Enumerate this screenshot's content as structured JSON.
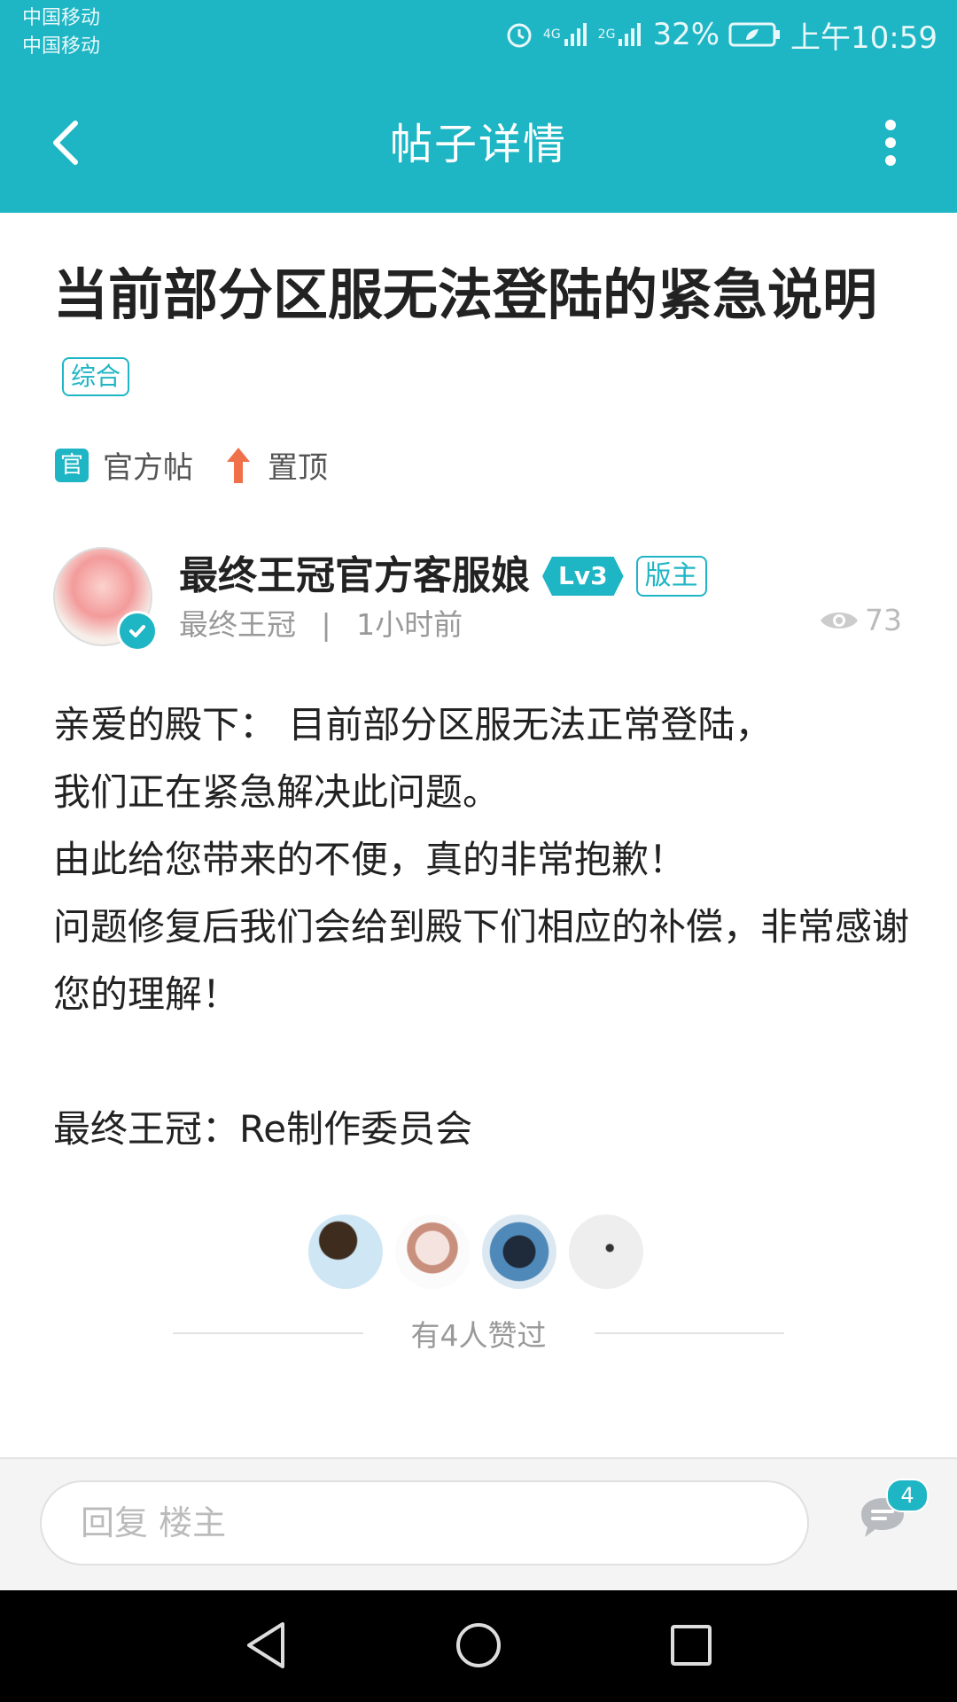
{
  "status_bar": {
    "carrier_1": "中国移动",
    "carrier_2": "中国移动",
    "net_1": "4G",
    "net_2": "2G",
    "battery": "32%",
    "time": "上午10:59"
  },
  "header": {
    "title": "帖子详情",
    "icons": {
      "back": "chevron-left-icon",
      "more": "more-vertical-icon"
    }
  },
  "post": {
    "title": "当前部分区服无法登陆的紧急说明",
    "category": "综合",
    "badges": {
      "official_icon": "官",
      "official": "官方帖",
      "pinned": "置顶"
    },
    "author": {
      "name": "最终王冠官方客服娘",
      "level": "Lv3",
      "role": "版主",
      "source": "最终王冠",
      "separator": "|",
      "time": "1小时前"
    },
    "views": "73",
    "body": [
      "亲爱的殿下： 目前部分区服无法正常登陆，",
      "我们正在紧急解决此问题。",
      "由此给您带来的不便，真的非常抱歉！",
      "问题修复后我们会给到殿下们相应的补偿，非常感谢您的理解！",
      "最终王冠：Re制作委员会"
    ],
    "likes_text": "有4人赞过"
  },
  "reply_bar": {
    "placeholder": "回复  楼主",
    "comment_count": "4"
  },
  "colors": {
    "accent": "#1eb5c4",
    "pin": "#f0704a"
  }
}
